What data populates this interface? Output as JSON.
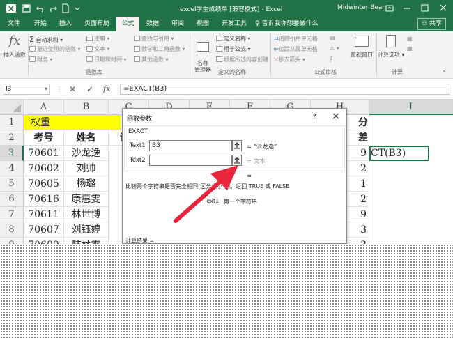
{
  "window": {
    "filename": "excel学生成绩单",
    "mode": "[兼容模式]",
    "separator": "-",
    "app": "Excel",
    "user": "Midwinter Bear"
  },
  "tabs": [
    "文件",
    "开始",
    "插入",
    "页面布局",
    "公式",
    "数据",
    "审阅",
    "视图",
    "开发工具"
  ],
  "active_tab": "公式",
  "tell_me": "告诉我你想要做什么",
  "share": "共享",
  "ribbon": {
    "insert_function": "插入函数",
    "autosum": "自动求和",
    "recent": "最近使用的函数",
    "financial": "财务",
    "logical": "逻辑",
    "text": "文本",
    "datetime": "日期和时间",
    "lookup": "查找与引用",
    "math": "数学和三角函数",
    "other": "其他函数",
    "group_library": "函数库",
    "name_manager": "名称\n管理器",
    "define_name": "定义名称",
    "use_in_formula": "用于公式",
    "create_from_selection": "根据所选内容创建",
    "group_names": "定义的名称",
    "trace_precedents": "追踪引用单元格",
    "trace_dependents": "追踪从属单元格",
    "remove_arrows": "移去箭头",
    "group_audit": "公式审核",
    "watch_window": "监视窗口",
    "calc_options": "计算选项",
    "group_calc": "计算"
  },
  "formula_bar": {
    "name_box": "I3",
    "formula": "=EXACT(B3)"
  },
  "columns": [
    "A",
    "B",
    "C",
    "D",
    "E",
    "F",
    "G",
    "H",
    "I"
  ],
  "selected_column": "I",
  "rows": [
    "1",
    "2",
    "3",
    "4",
    "5",
    "6",
    "7",
    "8",
    "9"
  ],
  "selected_row": "3",
  "sheet": {
    "row1_a": "权重",
    "headers": [
      "考号",
      "姓名",
      "语"
    ],
    "h_partial_row1": "分",
    "h_partial_row2": "差",
    "records": [
      {
        "id": "70601",
        "name": "沙龙逸",
        "h": "9"
      },
      {
        "id": "70602",
        "name": "刘帅",
        "h": "2"
      },
      {
        "id": "70605",
        "name": "杨璐",
        "h": "1"
      },
      {
        "id": "70616",
        "name": "康惠雯",
        "h": "2"
      },
      {
        "id": "70611",
        "name": "林世博",
        "h": "9"
      },
      {
        "id": "70607",
        "name": "刘钰婷",
        "h": "3"
      },
      {
        "id": "70609",
        "name": "韩林霖",
        "h": "3"
      }
    ],
    "active_cell_text": "CT(B3)"
  },
  "dialog": {
    "title": "函数参数",
    "help": "?",
    "close": "×",
    "function_name": "EXACT",
    "text1_label": "Text1",
    "text1_value": "B3",
    "text1_result": "= \"沙龙逸\"",
    "text2_label": "Text2",
    "text2_value": "",
    "text2_result": "= 文本",
    "equals": "=",
    "description": "比较两个字符串是否完全相同(区分大小写)。返回 TRUE 或 FALSE",
    "arg_help_name": "Text1",
    "arg_help_text": "第一个字符串",
    "calc_result_label": "计算结果 ="
  },
  "colors": {
    "excel_green": "#217346",
    "highlight_yellow": "#ffff00",
    "arrow_red": "#e8243c"
  }
}
